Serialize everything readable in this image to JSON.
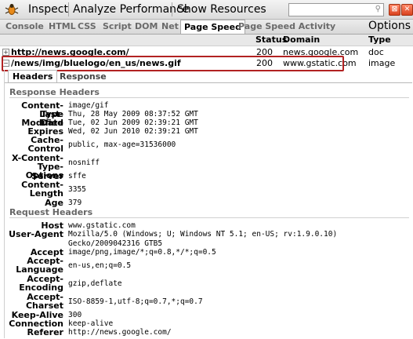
{
  "toolbar": {
    "inspect_label": "Inspect",
    "analyze_label": "Analyze Performance",
    "resources_label": "Show Resources",
    "search_placeholder": ""
  },
  "tabs": [
    {
      "label": "Console"
    },
    {
      "label": "HTML"
    },
    {
      "label": "CSS"
    },
    {
      "label": "Script"
    },
    {
      "label": "DOM"
    },
    {
      "label": "Net"
    },
    {
      "label": "Page Speed"
    },
    {
      "label": "Page Speed Activity"
    }
  ],
  "options_label": "Options",
  "net_columns": {
    "status": "Status",
    "domain": "Domain",
    "type": "Type"
  },
  "requests": [
    {
      "url": "http://news.google.com/",
      "status": "200",
      "domain": "news.google.com",
      "type": "doc",
      "expander": "+"
    },
    {
      "url": "/news/img/bluelogo/en_us/news.gif",
      "status": "200",
      "domain": "www.gstatic.com",
      "type": "image",
      "expander": "−"
    }
  ],
  "detail_tabs": {
    "headers": "Headers",
    "response": "Response"
  },
  "response_headers_title": "Response Headers",
  "response_headers": [
    {
      "key": "Content-Type",
      "value": "image/gif"
    },
    {
      "key": "Last-Modified",
      "value": "Thu, 28 May 2009 08:37:52 GMT"
    },
    {
      "key": "Date",
      "value": "Tue, 02 Jun 2009 02:39:21 GMT"
    },
    {
      "key": "Expires",
      "value": "Wed, 02 Jun 2010 02:39:21 GMT"
    },
    {
      "key": "Cache-Control",
      "value": "public, max-age=31536000"
    },
    {
      "key": "X-Content-Type-Options",
      "value": "nosniff"
    },
    {
      "key": "Server",
      "value": "sffe"
    },
    {
      "key": "Content-Length",
      "value": "3355"
    },
    {
      "key": "Age",
      "value": "379"
    }
  ],
  "request_headers_title": "Request Headers",
  "request_headers": [
    {
      "key": "Host",
      "value": "www.gstatic.com"
    },
    {
      "key": "User-Agent",
      "value": "Mozilla/5.0 (Windows; U; Windows NT 5.1; en-US; rv:1.9.0.10) Gecko/2009042316 GTB5"
    },
    {
      "key": "Accept",
      "value": "image/png,image/*;q=0.8,*/*;q=0.5"
    },
    {
      "key": "Accept-Language",
      "value": "en-us,en;q=0.5"
    },
    {
      "key": "Accept-Encoding",
      "value": "gzip,deflate"
    },
    {
      "key": "Accept-Charset",
      "value": "ISO-8859-1,utf-8;q=0.7,*;q=0.7"
    },
    {
      "key": "Keep-Alive",
      "value": "300"
    },
    {
      "key": "Connection",
      "value": "keep-alive"
    },
    {
      "key": "Referer",
      "value": "http://news.google.com/"
    }
  ],
  "window_buttons": {
    "minimize": "⊠",
    "close": "✕"
  }
}
